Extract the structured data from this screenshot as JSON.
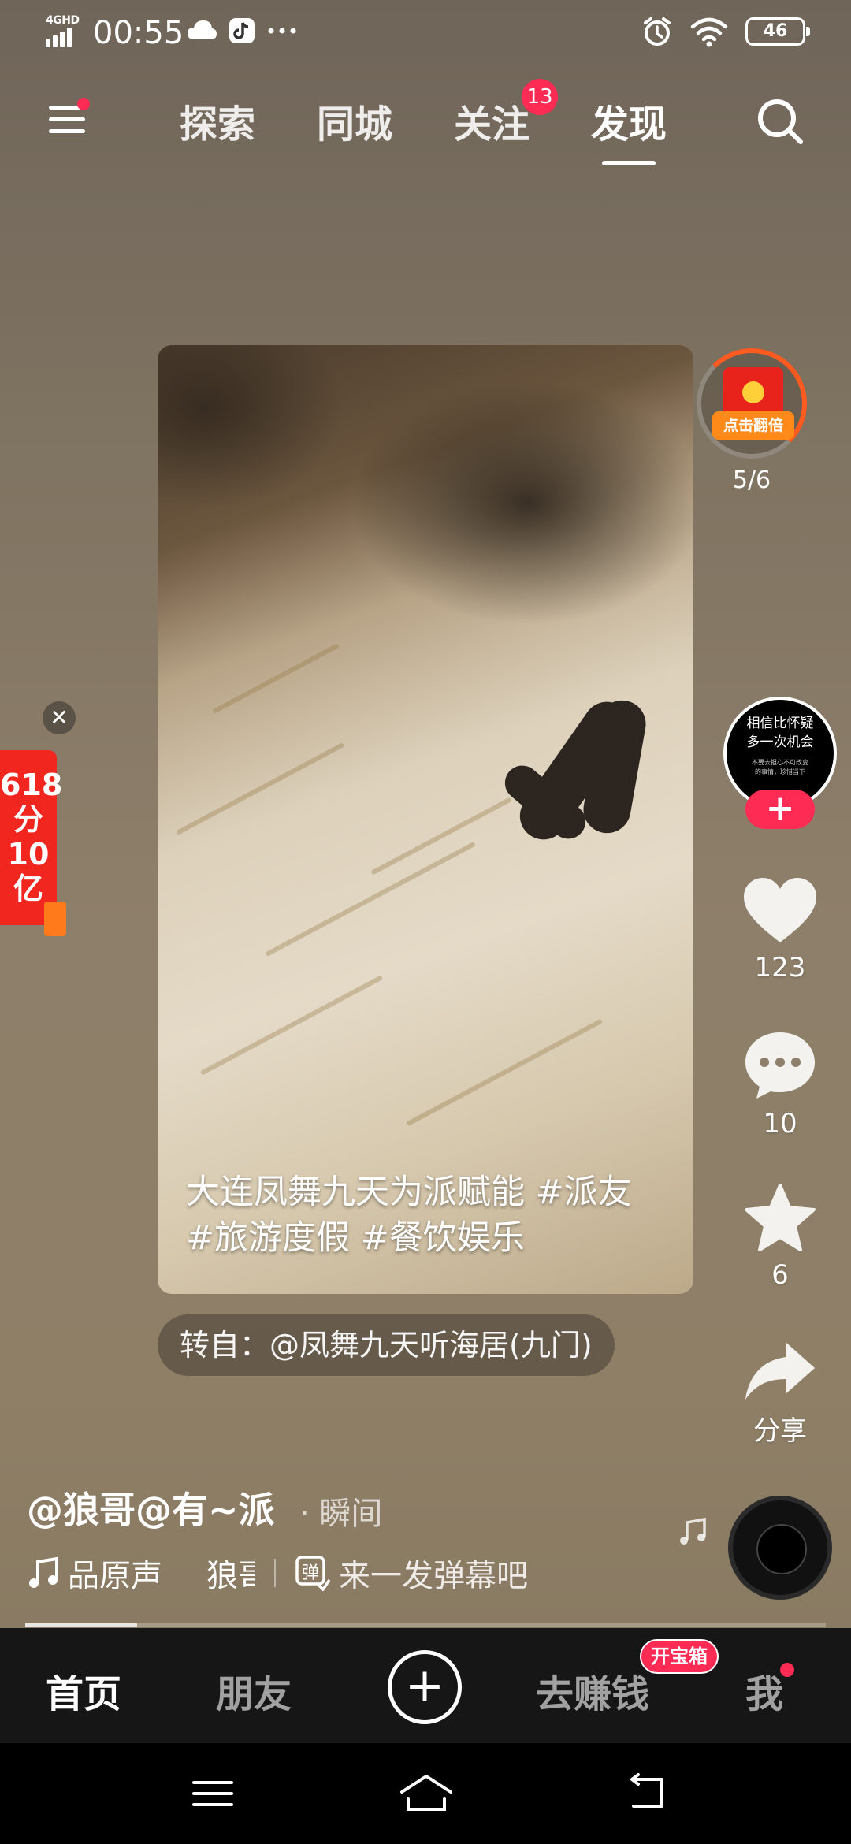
{
  "status_bar": {
    "network": "4GHD",
    "time": "00:55",
    "battery": "46"
  },
  "top_nav": {
    "tabs": [
      {
        "label": "探索"
      },
      {
        "label": "同城"
      },
      {
        "label": "关注"
      },
      {
        "label": "发现"
      }
    ],
    "follow_badge": "13",
    "active_tab": "发现"
  },
  "video": {
    "caption": "大连凤舞九天为派赋能 #派友 #旅游度假 #餐饮娱乐",
    "repost": "转自：@凤舞九天听海居(九门)"
  },
  "promo": {
    "close": "✕",
    "text": "618分10亿"
  },
  "side_actions": {
    "hongbao_label": "点击翻倍",
    "hongbao_progress": "5/6",
    "avatar_line1": "相信比怀疑",
    "avatar_line2": "多一次机会",
    "avatar_small": "不要去担心不可改变的事情，珍惜当下",
    "follow": "+",
    "likes": "123",
    "comments": "10",
    "favorites": "6",
    "share": "分享"
  },
  "info": {
    "author": "@狼哥@有~派",
    "moment": "· 瞬间",
    "music": "品原声",
    "music_author": "狼哥",
    "danmu_placeholder": "来一发弹幕吧",
    "progress": 0.14
  },
  "tabbar": {
    "items": [
      {
        "label": "首页"
      },
      {
        "label": "朋友"
      },
      {
        "label": "去赚钱"
      },
      {
        "label": "我"
      }
    ],
    "earn_badge": "开宝箱",
    "plus": "+"
  },
  "colors": {
    "accent": "#fe2c55",
    "hongbao": "#e8231b",
    "promo_red": "#f0261f",
    "tabbar_bg": "#161616"
  }
}
